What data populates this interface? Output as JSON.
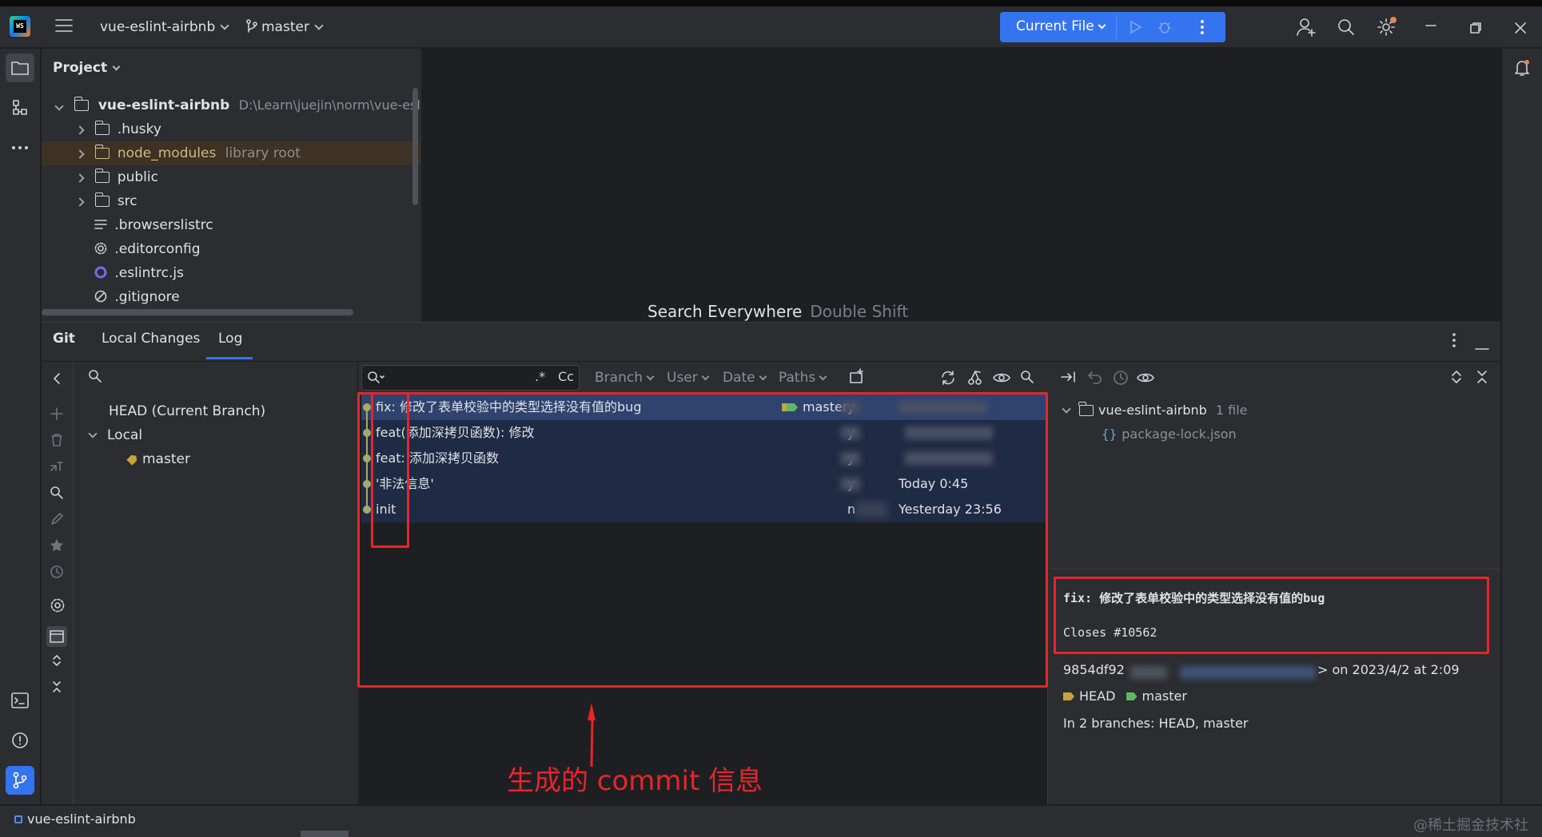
{
  "titlebar": {
    "project_name": "vue-eslint-airbnb",
    "branch": "master",
    "run_config": "Current File"
  },
  "project_panel": {
    "header": "Project",
    "root_name": "vue-eslint-airbnb",
    "root_path": "D:\\Learn\\juejin\\norm\\vue-eslint-a",
    "items": [
      {
        "label": "husky",
        "hint": ""
      },
      {
        "label": "node_modules",
        "hint": "library root"
      },
      {
        "label": "public",
        "hint": ""
      },
      {
        "label": "src",
        "hint": ""
      },
      {
        "label": ".browserslistrc",
        "hint": ""
      },
      {
        "label": ".editorconfig",
        "hint": ""
      },
      {
        "label": ".eslintrc.js",
        "hint": ""
      },
      {
        "label": ".gitignore",
        "hint": ""
      }
    ]
  },
  "editor": {
    "search_hint": "Search Everywhere",
    "search_shortcut": "Double Shift"
  },
  "git": {
    "title": "Git",
    "tabs": [
      "Local Changes",
      "Log"
    ],
    "branches": {
      "head": "HEAD (Current Branch)",
      "local": "Local",
      "master": "master"
    },
    "log_filters": {
      "regex": ".*",
      "case": "Cc",
      "branch": "Branch",
      "user": "User",
      "date": "Date",
      "paths": "Paths"
    },
    "commits": [
      {
        "subject": "fix: 修改了表单校验中的类型选择没有值的bug",
        "ref": "master",
        "author": "y",
        "date": ""
      },
      {
        "subject": "feat(添加深拷贝函数): 修改",
        "ref": "",
        "author": "y",
        "date": ""
      },
      {
        "subject": "feat: 添加深拷贝函数",
        "ref": "",
        "author": "y",
        "date": ""
      },
      {
        "subject": "'非法信息'",
        "ref": "",
        "author": "y",
        "date": "Today 0:45"
      },
      {
        "subject": "init",
        "ref": "",
        "author": "n",
        "date": "Yesterday 23:56"
      }
    ],
    "changes": {
      "root": "vue-eslint-airbnb",
      "count": "1 file",
      "file": "package-lock.json"
    },
    "details": {
      "message_title": "fix: 修改了表单校验中的类型选择没有值的bug",
      "message_body": "Closes #10562",
      "hash": "9854df92",
      "timestamp": "> on 2023/4/2 at 2:09",
      "ref_head": "HEAD",
      "ref_master": "master",
      "branches_line": "In 2 branches: HEAD, master"
    }
  },
  "annotation": {
    "text": "生成的 commit 信息"
  },
  "statusbar": {
    "project": "vue-eslint-airbnb",
    "watermark": "@稀土掘金技术社区"
  },
  "colors": {
    "accent": "#3574f0",
    "annotation_red": "#e5262b",
    "selection": "#2e436e"
  }
}
